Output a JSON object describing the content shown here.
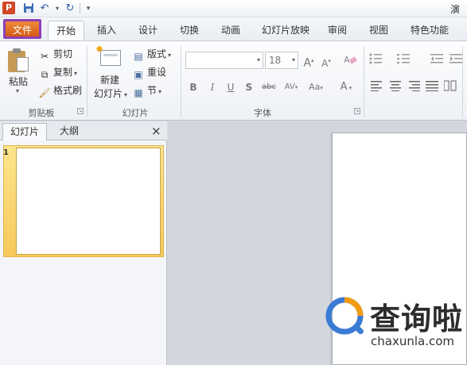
{
  "titlebar": {
    "app_logo": "P",
    "save_icon": "save-icon",
    "undo_icon": "undo-icon",
    "redo_icon": "redo-icon",
    "window_title": "演"
  },
  "tabs": {
    "file": "文件",
    "items": [
      "开始",
      "插入",
      "设计",
      "切换",
      "动画",
      "幻灯片放映",
      "审阅",
      "视图",
      "特色功能"
    ],
    "active": "开始"
  },
  "ribbon": {
    "clipboard": {
      "paste": "粘贴",
      "cut": "剪切",
      "copy": "复制",
      "format_painter": "格式刷",
      "label": "剪贴板"
    },
    "slides": {
      "new_slide_line1": "新建",
      "new_slide_line2": "幻灯片",
      "layout": "版式",
      "reset": "重设",
      "section": "节",
      "label": "幻灯片"
    },
    "font": {
      "font_name": "",
      "font_size": "18",
      "grow": "A",
      "shrink": "A",
      "clear": "清",
      "bold": "B",
      "italic": "I",
      "underline": "U",
      "shadow": "S",
      "strike": "abc",
      "spacing": "AV",
      "case": "Aa",
      "color": "A",
      "label": "字体"
    }
  },
  "panel": {
    "tab_slides": "幻灯片",
    "tab_outline": "大纲",
    "close": "×",
    "slide_number": "1"
  },
  "watermark": {
    "name": "查询啦",
    "url": "chaxunla.com"
  },
  "colors": {
    "file_tab": "#d25a16",
    "file_tab_highlight": "#8e3fb8",
    "selected_thumb": "#f6c95b",
    "logo_blue": "#3a7bd5",
    "logo_orange": "#f39c12"
  }
}
